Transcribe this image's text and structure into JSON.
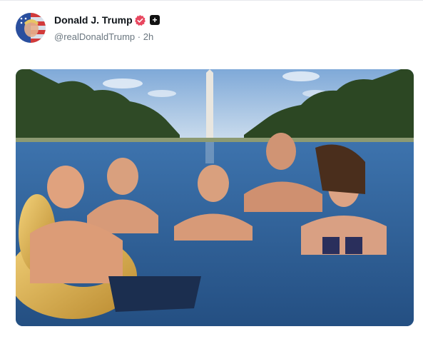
{
  "post": {
    "author_name": "Donald J. Trump",
    "handle": "@realDonaldTrump",
    "separator": "·",
    "time": "2h"
  },
  "icons": {
    "avatar": "avatar-flag-portrait",
    "verified": "verified-badge-icon",
    "follow": "plus-icon"
  },
  "colors": {
    "verified_badge": "#e8475f",
    "handle_gray": "#6b7780",
    "water": "#2f6aa8",
    "sky": "#a9c8e6",
    "trees": "#2f4a26"
  }
}
